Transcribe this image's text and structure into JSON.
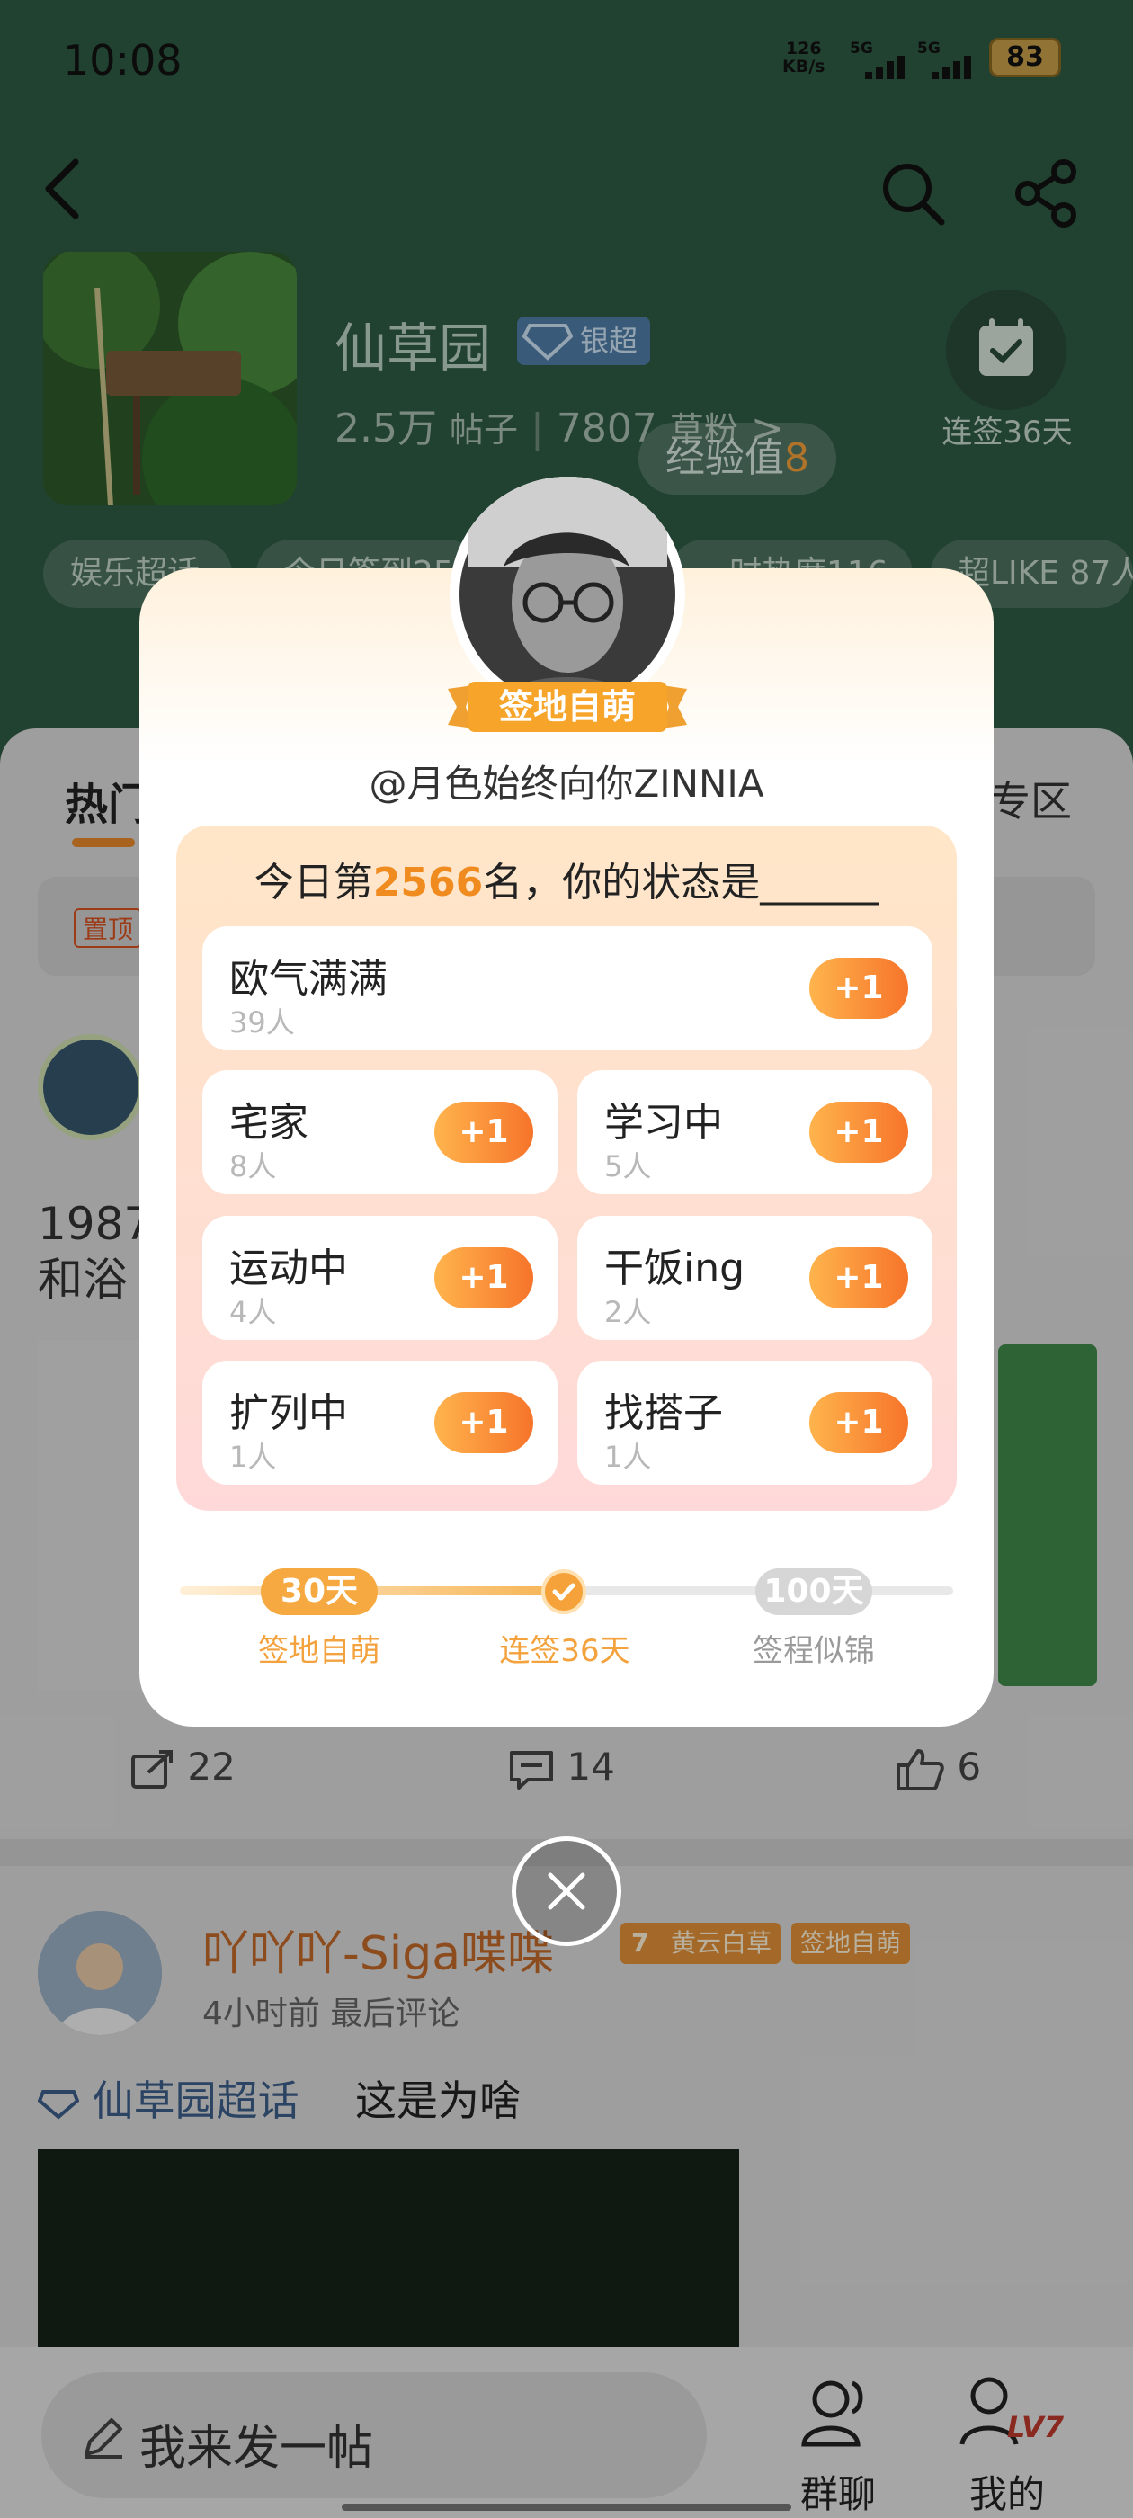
{
  "status_bar": {
    "time": "10:08",
    "net_speed": "126",
    "net_unit": "KB/s",
    "sim1": "5G",
    "sim2": "5G",
    "battery": "83"
  },
  "forum": {
    "name": "仙草园",
    "badge": "银超",
    "posts": "2.5万",
    "posts_label": "帖子",
    "fans": "7807",
    "fans_label": "草粉",
    "fans_chevron": ">",
    "exp_label": "经验值",
    "exp_value": "8",
    "checkin_label": "连签36天",
    "chips": [
      "娱乐超话",
      "今日签到25…",
      "…时热度116…",
      "超LIKE 87人"
    ]
  },
  "tabs": {
    "hot": "热门",
    "zone": "专区"
  },
  "pinned": {
    "tag": "置顶"
  },
  "post1": {
    "text_line1": "1987",
    "text_line2": "和浴",
    "comments_count": "14",
    "shares_count": "22",
    "likes_count": "6"
  },
  "post2": {
    "author": "吖吖吖-Siga喋喋",
    "level_badge": "黄云白草",
    "level_num": "7",
    "sign_badge": "签地自萌",
    "meta": "4小时前 最后评论",
    "topic": "仙草园超话",
    "title": "这是为啥"
  },
  "bottom_nav": {
    "compose_placeholder": "我来发一帖",
    "group_chat": "群聊",
    "mine": "我的",
    "level": "LV7"
  },
  "modal": {
    "ribbon": "签地自萌",
    "handle": "@月色始终向你ZINNIA",
    "question_prefix": "今日第",
    "rank": "2566",
    "question_suffix": "名，你的状态是______",
    "plus_label": "+1",
    "statuses": [
      {
        "name": "欧气满满",
        "count": "39人"
      },
      {
        "name": "宅家",
        "count": "8人"
      },
      {
        "name": "学习中",
        "count": "5人"
      },
      {
        "name": "运动中",
        "count": "4人"
      },
      {
        "name": "干饭ing",
        "count": "2人"
      },
      {
        "name": "扩列中",
        "count": "1人"
      },
      {
        "name": "找搭子",
        "count": "1人"
      }
    ],
    "progress": {
      "fill_fraction": 0.5,
      "milestones": [
        {
          "value": "30天",
          "label": "签地自萌"
        },
        {
          "value": "",
          "label": "连签36天"
        },
        {
          "value": "100天",
          "label": "签程似锦"
        }
      ]
    }
  },
  "colors": {
    "accent_orange": "#f08b1f",
    "hero_green": "#2e5a44",
    "topic_blue": "#3d5f8a"
  }
}
